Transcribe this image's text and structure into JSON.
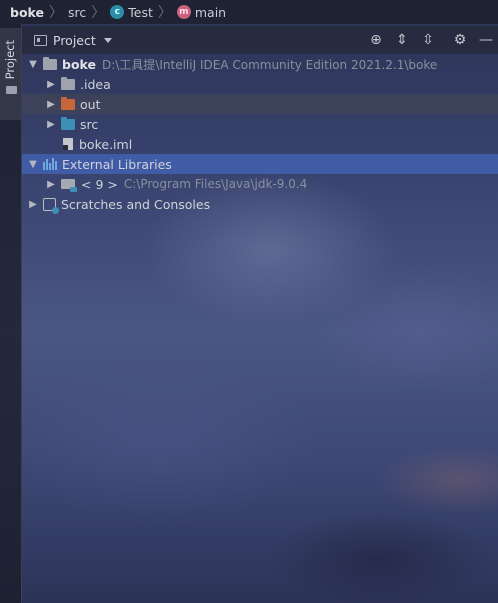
{
  "breadcrumb": {
    "items": [
      {
        "label": "boke",
        "icon": ""
      },
      {
        "label": "src",
        "icon": ""
      },
      {
        "label": "Test",
        "icon": "class-icon"
      },
      {
        "label": "main",
        "icon": "method-icon"
      }
    ],
    "class_icon_letter": "c",
    "method_icon_letter": "m"
  },
  "strip": {
    "tab_label": "Project"
  },
  "panel": {
    "title": "Project",
    "actions": [
      {
        "name": "locate-icon",
        "glyph": "⊕"
      },
      {
        "name": "expand-all-icon",
        "glyph": "⇕"
      },
      {
        "name": "collapse-all-icon",
        "glyph": "⇳"
      },
      {
        "name": "gear-icon",
        "glyph": "⚙"
      },
      {
        "name": "minimize-icon",
        "glyph": "—"
      }
    ]
  },
  "tree": {
    "root": {
      "label": "boke",
      "path": "D:\\工具提\\IntelliJ IDEA Community Edition 2021.2.1\\boke"
    },
    "children": [
      {
        "label": ".idea",
        "folder_color": "grey"
      },
      {
        "label": "out",
        "folder_color": "orange"
      },
      {
        "label": "src",
        "folder_color": "blue"
      },
      {
        "label": "boke.iml",
        "type": "file"
      }
    ],
    "external_libraries": {
      "label": "External Libraries"
    },
    "jdk": {
      "label": "< 9 >",
      "path": "C:\\Program Files\\Java\\jdk-9.0.4"
    },
    "scratches": {
      "label": "Scratches and Consoles"
    }
  },
  "colors": {
    "selection": "#4260b0",
    "folder_orange": "#c6663a",
    "folder_blue": "#3d8fb5"
  }
}
